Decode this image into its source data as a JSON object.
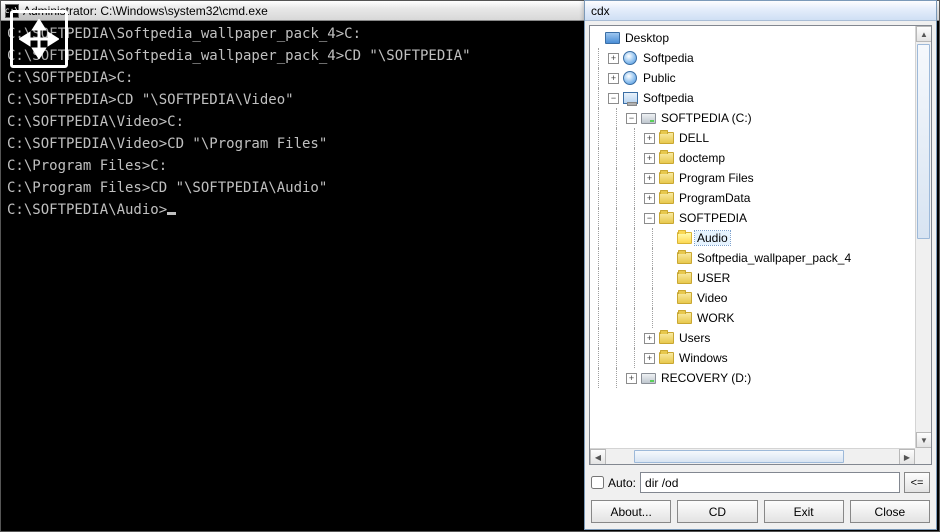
{
  "cmd": {
    "title": "Administrator: C:\\Windows\\system32\\cmd.exe",
    "lines": [
      "",
      "C:\\SOFTPEDIA\\Softpedia_wallpaper_pack_4>C:",
      "",
      "C:\\SOFTPEDIA\\Softpedia_wallpaper_pack_4>CD \"\\SOFTPEDIA\"",
      "",
      "C:\\SOFTPEDIA>C:",
      "",
      "C:\\SOFTPEDIA>CD \"\\SOFTPEDIA\\Video\"",
      "",
      "C:\\SOFTPEDIA\\Video>C:",
      "",
      "C:\\SOFTPEDIA\\Video>CD \"\\Program Files\"",
      "",
      "C:\\Program Files>C:",
      "",
      "C:\\Program Files>CD \"\\SOFTPEDIA\\Audio\"",
      "",
      "C:\\SOFTPEDIA\\Audio>"
    ]
  },
  "cdx": {
    "title": "cdx",
    "tree": [
      {
        "depth": 0,
        "expander": "",
        "icon": "desktop",
        "label": "Desktop"
      },
      {
        "depth": 1,
        "expander": "+",
        "icon": "user",
        "label": "Softpedia"
      },
      {
        "depth": 1,
        "expander": "+",
        "icon": "user",
        "label": "Public"
      },
      {
        "depth": 1,
        "expander": "-",
        "icon": "computer",
        "label": "Softpedia"
      },
      {
        "depth": 2,
        "expander": "-",
        "icon": "drive",
        "label": "SOFTPEDIA (C:)"
      },
      {
        "depth": 3,
        "expander": "+",
        "icon": "folder",
        "label": "DELL"
      },
      {
        "depth": 3,
        "expander": "+",
        "icon": "folder",
        "label": "doctemp"
      },
      {
        "depth": 3,
        "expander": "+",
        "icon": "folder",
        "label": "Program Files"
      },
      {
        "depth": 3,
        "expander": "+",
        "icon": "folder",
        "label": "ProgramData"
      },
      {
        "depth": 3,
        "expander": "-",
        "icon": "folder",
        "label": "SOFTPEDIA"
      },
      {
        "depth": 4,
        "expander": "",
        "icon": "folder-open",
        "label": "Audio",
        "selected": true
      },
      {
        "depth": 4,
        "expander": "",
        "icon": "folder",
        "label": "Softpedia_wallpaper_pack_4"
      },
      {
        "depth": 4,
        "expander": "",
        "icon": "folder",
        "label": "USER"
      },
      {
        "depth": 4,
        "expander": "",
        "icon": "folder",
        "label": "Video"
      },
      {
        "depth": 4,
        "expander": "",
        "icon": "folder",
        "label": "WORK"
      },
      {
        "depth": 3,
        "expander": "+",
        "icon": "folder",
        "label": "Users"
      },
      {
        "depth": 3,
        "expander": "+",
        "icon": "folder",
        "label": "Windows"
      },
      {
        "depth": 2,
        "expander": "+",
        "icon": "drive",
        "label": "RECOVERY (D:)"
      }
    ],
    "auto": {
      "checkbox_label": "Auto:",
      "checked": false,
      "input_value": "dir /od",
      "run_label": "<="
    },
    "buttons": {
      "about": "About...",
      "cd": "CD",
      "exit": "Exit",
      "close": "Close"
    }
  }
}
